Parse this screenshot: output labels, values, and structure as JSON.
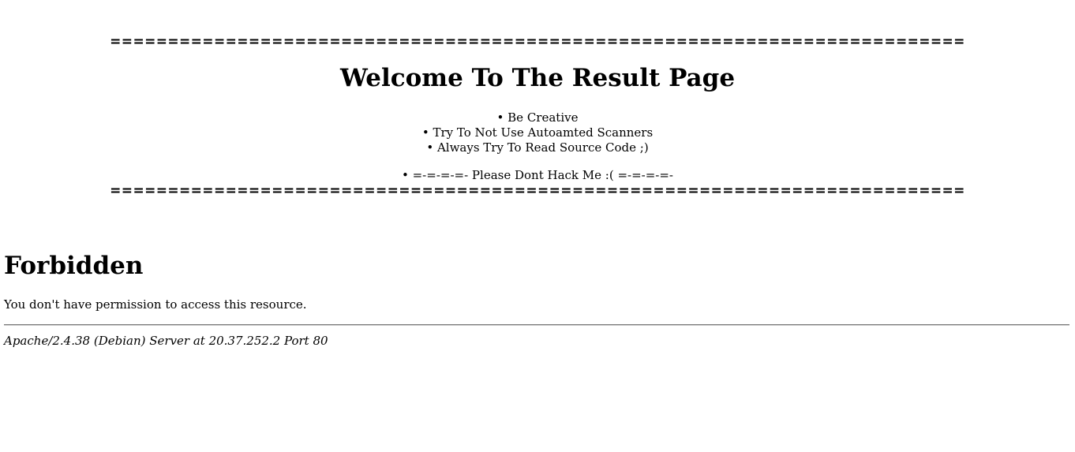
{
  "banner": {
    "divider_top": "==========================================================================",
    "title": "Welcome To The Result Page",
    "tips": [
      "Be Creative",
      "Try To Not Use Autoamted Scanners",
      "Always Try To Read Source Code ;)"
    ],
    "warning": "=-=-=-=- Please Dont Hack Me :( =-=-=-=-",
    "divider_bottom": "=========================================================================="
  },
  "error": {
    "heading": "Forbidden",
    "message": "You don't have permission to access this resource.",
    "server_signature": "Apache/2.4.38 (Debian) Server at 20.37.252.2 Port 80"
  }
}
